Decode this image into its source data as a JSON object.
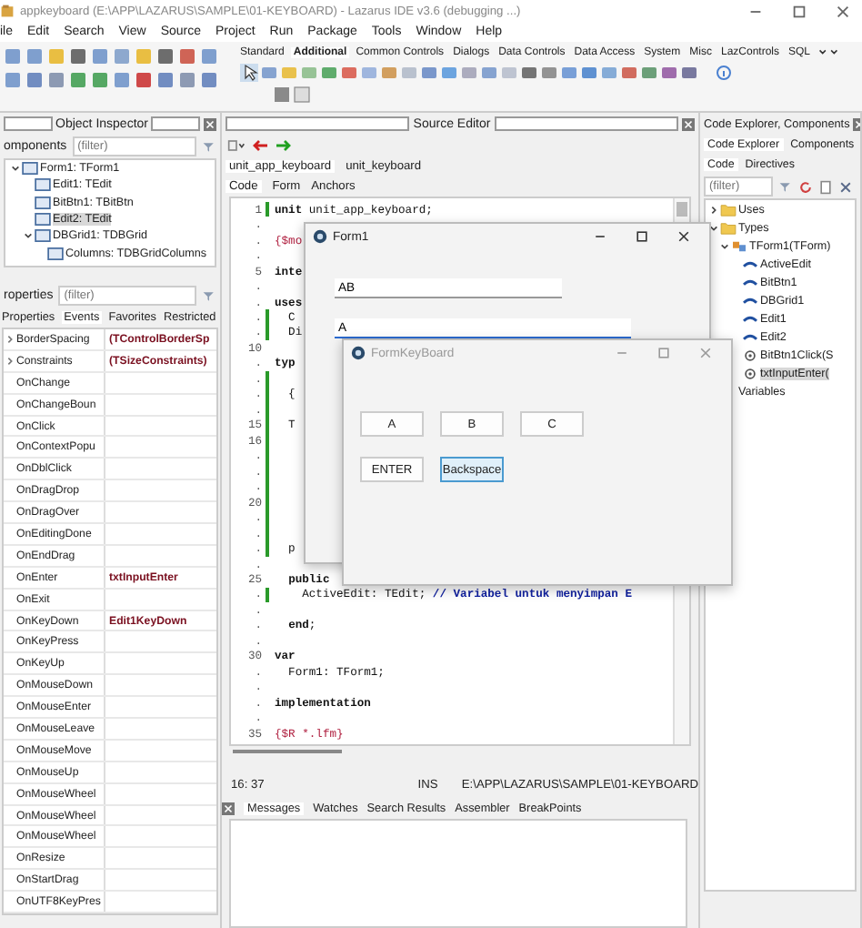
{
  "window": {
    "title": "appkeyboard (E:\\APP\\LAZARUS\\SAMPLE\\01-KEYBOARD) - Lazarus IDE v3.6 (debugging ...)"
  },
  "menu": [
    "ile",
    "Edit",
    "Search",
    "View",
    "Source",
    "Project",
    "Run",
    "Package",
    "Tools",
    "Window",
    "Help"
  ],
  "palette_tabs": [
    {
      "label": "Standard",
      "selected": false
    },
    {
      "label": "Additional",
      "selected": true
    },
    {
      "label": "Common Controls",
      "selected": false
    },
    {
      "label": "Dialogs",
      "selected": false
    },
    {
      "label": "Data Controls",
      "selected": false
    },
    {
      "label": "Data Access",
      "selected": false
    },
    {
      "label": "System",
      "selected": false
    },
    {
      "label": "Misc",
      "selected": false
    },
    {
      "label": "LazControls",
      "selected": false
    },
    {
      "label": "SQL",
      "selected": false
    }
  ],
  "object_inspector": {
    "title": "Object Inspector",
    "components_label": "omponents",
    "components_filter": {
      "placeholder": "(filter)"
    },
    "tree": [
      {
        "label": "Form1: TForm1",
        "selected": false,
        "expanded": true,
        "children": [
          {
            "label": "Edit1: TEdit",
            "selected": false
          },
          {
            "label": "BitBtn1: TBitBtn",
            "selected": false
          },
          {
            "label": "Edit2: TEdit",
            "selected": true
          },
          {
            "label": "DBGrid1: TDBGrid",
            "selected": false,
            "expanded": true,
            "children": [
              {
                "label": "Columns: TDBGridColumns",
                "selected": false
              }
            ]
          }
        ]
      }
    ],
    "properties_label": "roperties",
    "properties_filter": {
      "placeholder": "(filter)"
    },
    "tabs": [
      {
        "label": "Properties",
        "selected": false
      },
      {
        "label": "Events",
        "selected": true
      },
      {
        "label": "Favorites",
        "selected": false
      },
      {
        "label": "Restricted",
        "selected": false
      }
    ],
    "rows": [
      {
        "name": "BorderSpacing",
        "value": "(TControlBorderSp",
        "expandable": true
      },
      {
        "name": "Constraints",
        "value": "(TSizeConstraints)",
        "expandable": true
      },
      {
        "name": "OnChange",
        "expandable": false
      },
      {
        "name": "OnChangeBoun",
        "expandable": false
      },
      {
        "name": "OnClick",
        "expandable": false
      },
      {
        "name": "OnContextPopu",
        "expandable": false
      },
      {
        "name": "OnDblClick",
        "expandable": false
      },
      {
        "name": "OnDragDrop",
        "expandable": false
      },
      {
        "name": "OnDragOver",
        "expandable": false
      },
      {
        "name": "OnEditingDone",
        "expandable": false
      },
      {
        "name": "OnEndDrag",
        "expandable": false
      },
      {
        "name": "OnEnter",
        "value": "txtInputEnter",
        "expandable": false
      },
      {
        "name": "OnExit",
        "expandable": false
      },
      {
        "name": "OnKeyDown",
        "value": "Edit1KeyDown",
        "expandable": false
      },
      {
        "name": "OnKeyPress",
        "expandable": false
      },
      {
        "name": "OnKeyUp",
        "expandable": false
      },
      {
        "name": "OnMouseDown",
        "expandable": false
      },
      {
        "name": "OnMouseEnter",
        "expandable": false
      },
      {
        "name": "OnMouseLeave",
        "expandable": false
      },
      {
        "name": "OnMouseMove",
        "expandable": false
      },
      {
        "name": "OnMouseUp",
        "expandable": false
      },
      {
        "name": "OnMouseWheel",
        "expandable": false
      },
      {
        "name": "OnMouseWheel",
        "expandable": false
      },
      {
        "name": "OnMouseWheel",
        "expandable": false
      },
      {
        "name": "OnResize",
        "expandable": false
      },
      {
        "name": "OnStartDrag",
        "expandable": false
      },
      {
        "name": "OnUTF8KeyPres",
        "expandable": false
      }
    ]
  },
  "source_editor": {
    "title": "Source Editor",
    "file_tabs": [
      {
        "label": "unit_app_keyboard",
        "selected": true
      },
      {
        "label": "unit_keyboard",
        "selected": false
      }
    ],
    "view_tabs": [
      {
        "label": "Code",
        "selected": true
      },
      {
        "label": "Form",
        "selected": false
      },
      {
        "label": "Anchors",
        "selected": false
      }
    ],
    "lines": [
      {
        "gutter": "1",
        "text": "**unit** unit_app_keyboard;",
        "modified": true
      },
      {
        "gutter": ".",
        "modified": false
      },
      {
        "gutter": ".",
        "directive": "{$mo",
        "modified": false
      },
      {
        "gutter": ".",
        "modified": false
      },
      {
        "gutter": "5",
        "text": "**inte**",
        "modified": false
      },
      {
        "gutter": ".",
        "modified": false
      },
      {
        "gutter": ".",
        "text": "**uses**",
        "modified": false
      },
      {
        "gutter": ".",
        "text": "  C",
        "modified": true
      },
      {
        "gutter": ".",
        "text": "  Di",
        "modified": true
      },
      {
        "gutter": "10",
        "modified": false
      },
      {
        "gutter": ".",
        "text": "**typ**",
        "modified": false
      },
      {
        "gutter": ".",
        "modified": true
      },
      {
        "gutter": ".",
        "text": "  {",
        "modified": true
      },
      {
        "gutter": ".",
        "modified": true
      },
      {
        "gutter": "15",
        "text": "  T",
        "modified": true
      },
      {
        "gutter": "16",
        "modified": true
      },
      {
        "gutter": ".",
        "modified": true
      },
      {
        "gutter": ".",
        "modified": true
      },
      {
        "gutter": ".",
        "modified": true
      },
      {
        "gutter": "20",
        "modified": true
      },
      {
        "gutter": ".",
        "modified": true
      },
      {
        "gutter": ".",
        "modified": true
      },
      {
        "gutter": ".",
        "text": "  p",
        "modified": true
      },
      {
        "gutter": ".",
        "modified": false
      },
      {
        "gutter": "25",
        "text": "  **public**",
        "modified": false
      },
      {
        "gutter": ".",
        "text": "    ActiveEdit: TEdit; ",
        "comment": "// Variabel untuk menyimpan E",
        "modified": true
      },
      {
        "gutter": ".",
        "modified": false
      },
      {
        "gutter": ".",
        "text": "  **end**;",
        "modified": false
      },
      {
        "gutter": ".",
        "modified": false
      },
      {
        "gutter": "30",
        "text": "**var**",
        "modified": false
      },
      {
        "gutter": ".",
        "text": "  Form1: TForm1;",
        "modified": false
      },
      {
        "gutter": ".",
        "modified": false
      },
      {
        "gutter": ".",
        "text": "**implementation**",
        "modified": false
      },
      {
        "gutter": ".",
        "modified": false
      },
      {
        "gutter": "35",
        "directive": "{$R *.lfm}",
        "modified": false
      }
    ],
    "status": {
      "position": "16: 37",
      "mode": "INS",
      "path": "E:\\APP\\LAZARUS\\SAMPLE\\01-KEYBOARD"
    }
  },
  "messages": {
    "tabs": [
      {
        "label": "Messages",
        "selected": true
      },
      {
        "label": "Watches",
        "selected": false
      },
      {
        "label": "Search Results",
        "selected": false
      },
      {
        "label": "Assembler",
        "selected": false
      },
      {
        "label": "BreakPoints",
        "selected": false
      }
    ]
  },
  "code_explorer": {
    "title": "Code Explorer, Components",
    "tabs": [
      {
        "label": "Code Explorer",
        "selected": true
      },
      {
        "label": "Components",
        "selected": false
      }
    ],
    "sub_tabs": [
      {
        "label": "Code",
        "selected": true
      },
      {
        "label": "Directives",
        "selected": false
      }
    ],
    "filter": {
      "placeholder": "(filter)"
    },
    "tree": [
      {
        "label": "Uses",
        "kind": "folder",
        "selected": false,
        "expanded": false
      },
      {
        "label": "Types",
        "kind": "folder",
        "selected": false,
        "expanded": true,
        "children": [
          {
            "label": "TForm1(TForm)",
            "kind": "class",
            "selected": false,
            "expanded": true,
            "children": [
              {
                "label": "ActiveEdit",
                "kind": "field",
                "selected": false
              },
              {
                "label": "BitBtn1",
                "kind": "field",
                "selected": false
              },
              {
                "label": "DBGrid1",
                "kind": "field",
                "selected": false
              },
              {
                "label": "Edit1",
                "kind": "field",
                "selected": false
              },
              {
                "label": "Edit2",
                "kind": "field",
                "selected": false
              },
              {
                "label": "BitBtn1Click(S",
                "kind": "method",
                "selected": false
              },
              {
                "label": "txtInputEnter(",
                "kind": "method",
                "selected": true
              }
            ]
          }
        ]
      },
      {
        "label": "Variables",
        "kind": "section",
        "selected": false
      }
    ]
  },
  "form1": {
    "title": "Form1",
    "fields": [
      {
        "value": "AB",
        "focused": false
      },
      {
        "value": "A",
        "focused": true
      }
    ]
  },
  "keyboard_form": {
    "title": "FormKeyBoard",
    "keys": [
      {
        "label": "A",
        "hovered": false
      },
      {
        "label": "B",
        "hovered": false
      },
      {
        "label": "C",
        "hovered": false
      },
      {
        "label": "ENTER",
        "hovered": false
      },
      {
        "label": "Backspace",
        "hovered": true
      }
    ]
  }
}
